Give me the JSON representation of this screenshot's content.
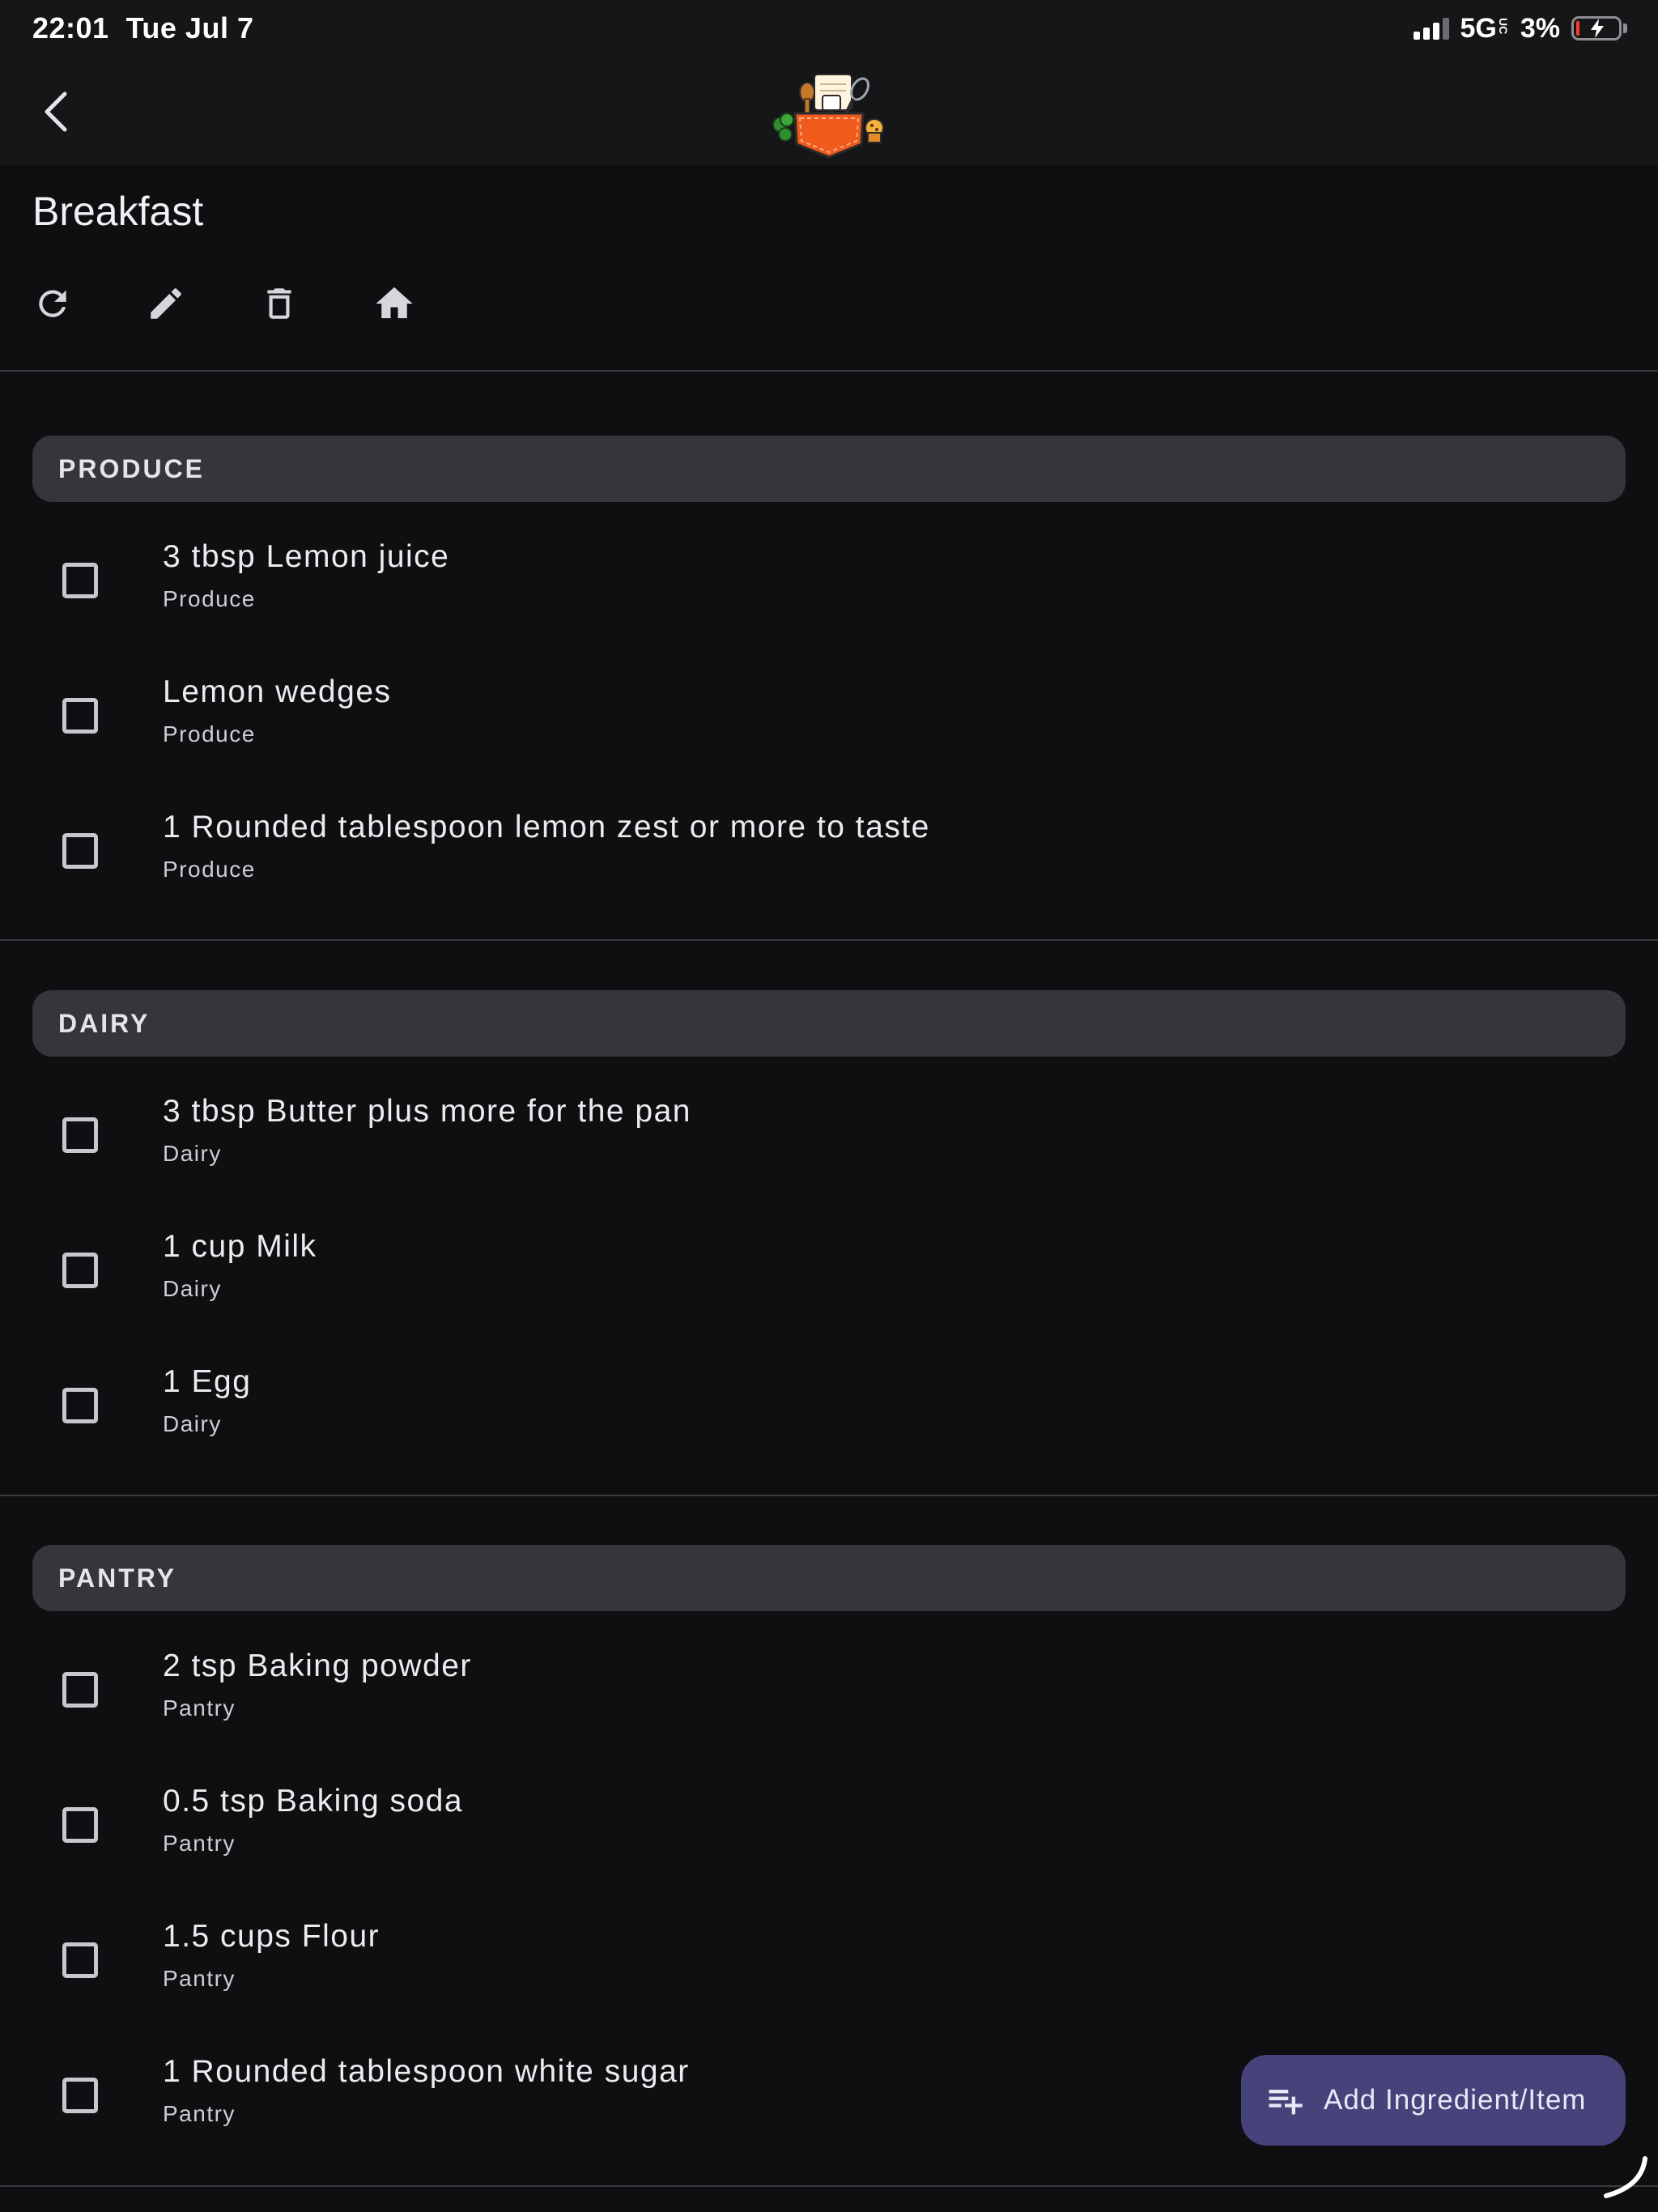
{
  "status_bar": {
    "time": "22:01",
    "date": "Tue Jul 7",
    "network": "5G",
    "network_suffix": "UC",
    "battery_percent": "3%",
    "battery_level": 0.03,
    "charging": true
  },
  "app_bar": {
    "back_icon": "chevron-left-icon",
    "logo_icon": "pocket-kitchen-logo"
  },
  "page": {
    "title": "Breakfast"
  },
  "toolbar": {
    "actions": [
      {
        "icon": "refresh-icon"
      },
      {
        "icon": "pencil-icon"
      },
      {
        "icon": "trash-icon"
      },
      {
        "icon": "home-icon"
      }
    ]
  },
  "sections": [
    {
      "name": "PRODUCE",
      "items": [
        {
          "title": "3 tbsp Lemon juice",
          "category": "Produce",
          "checked": false
        },
        {
          "title": "Lemon wedges",
          "category": "Produce",
          "checked": false
        },
        {
          "title": "1 Rounded tablespoon lemon zest or more to taste",
          "category": "Produce",
          "checked": false
        }
      ]
    },
    {
      "name": "DAIRY",
      "items": [
        {
          "title": "3 tbsp Butter plus more for the pan",
          "category": "Dairy",
          "checked": false
        },
        {
          "title": "1 cup Milk",
          "category": "Dairy",
          "checked": false
        },
        {
          "title": "1 Egg",
          "category": "Dairy",
          "checked": false
        }
      ]
    },
    {
      "name": "PANTRY",
      "items": [
        {
          "title": "2 tsp Baking powder",
          "category": "Pantry",
          "checked": false
        },
        {
          "title": "0.5 tsp Baking soda",
          "category": "Pantry",
          "checked": false
        },
        {
          "title": "1.5 cups Flour",
          "category": "Pantry",
          "checked": false
        },
        {
          "title": "1 Rounded tablespoon white sugar",
          "category": "Pantry",
          "checked": false
        }
      ]
    }
  ],
  "fab": {
    "label": "Add Ingredient/Item",
    "icon": "playlist-add-icon"
  },
  "colors": {
    "background": "#0f0f11",
    "bar": "#161619",
    "section_header": "#36353b",
    "fab": "#46437a",
    "logo_orange": "#f05a1a"
  }
}
